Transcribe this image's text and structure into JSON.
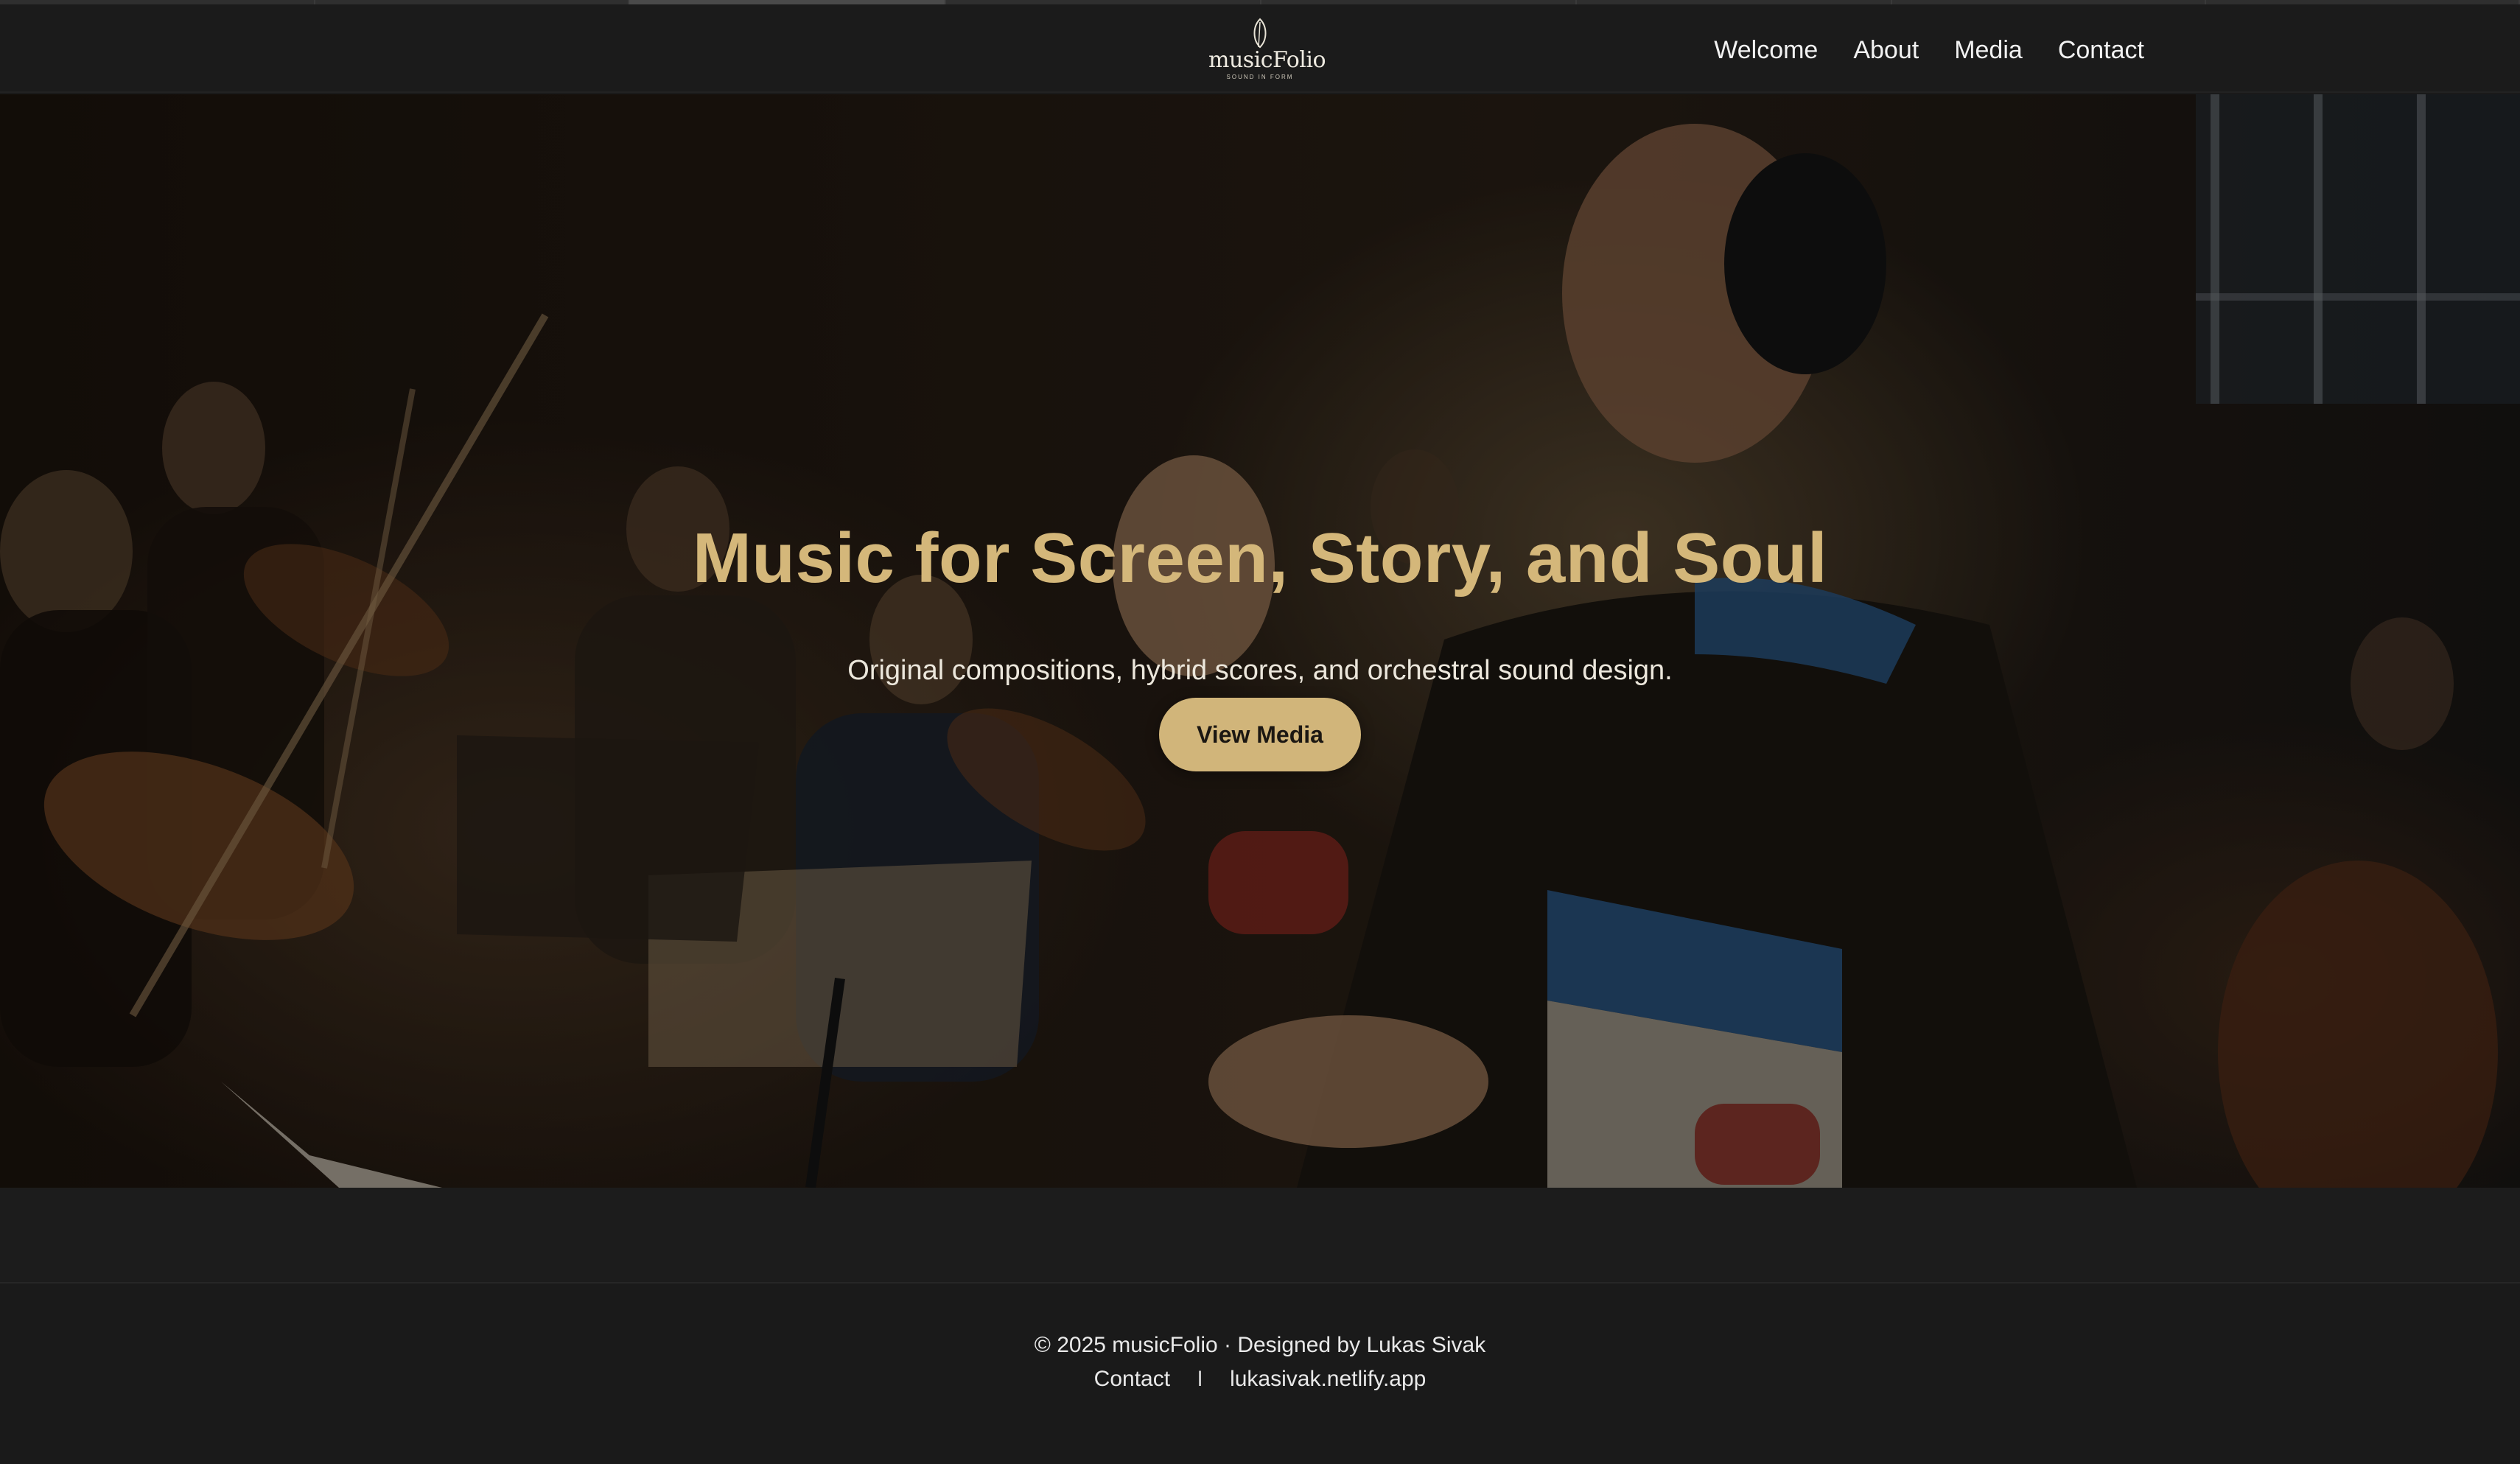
{
  "brand": {
    "name": "musicFolio",
    "tagline": "SOUND IN FORM"
  },
  "nav": {
    "items": [
      {
        "label": "Welcome"
      },
      {
        "label": "About"
      },
      {
        "label": "Media"
      },
      {
        "label": "Contact"
      }
    ]
  },
  "hero": {
    "title": "Music for Screen, Story, and Soul",
    "subtitle": "Original compositions, hybrid scores, and orchestral sound design.",
    "cta_label": "View Media",
    "accent_color": "#d1b57a"
  },
  "footer": {
    "copyright": "© 2025 musicFolio · Designed by Lukas Sivak",
    "links": [
      {
        "label": "Contact"
      },
      {
        "label": "lukasivak.netlify.app"
      }
    ],
    "separator": "I"
  },
  "icons": {
    "logo": "leaf-icon"
  }
}
